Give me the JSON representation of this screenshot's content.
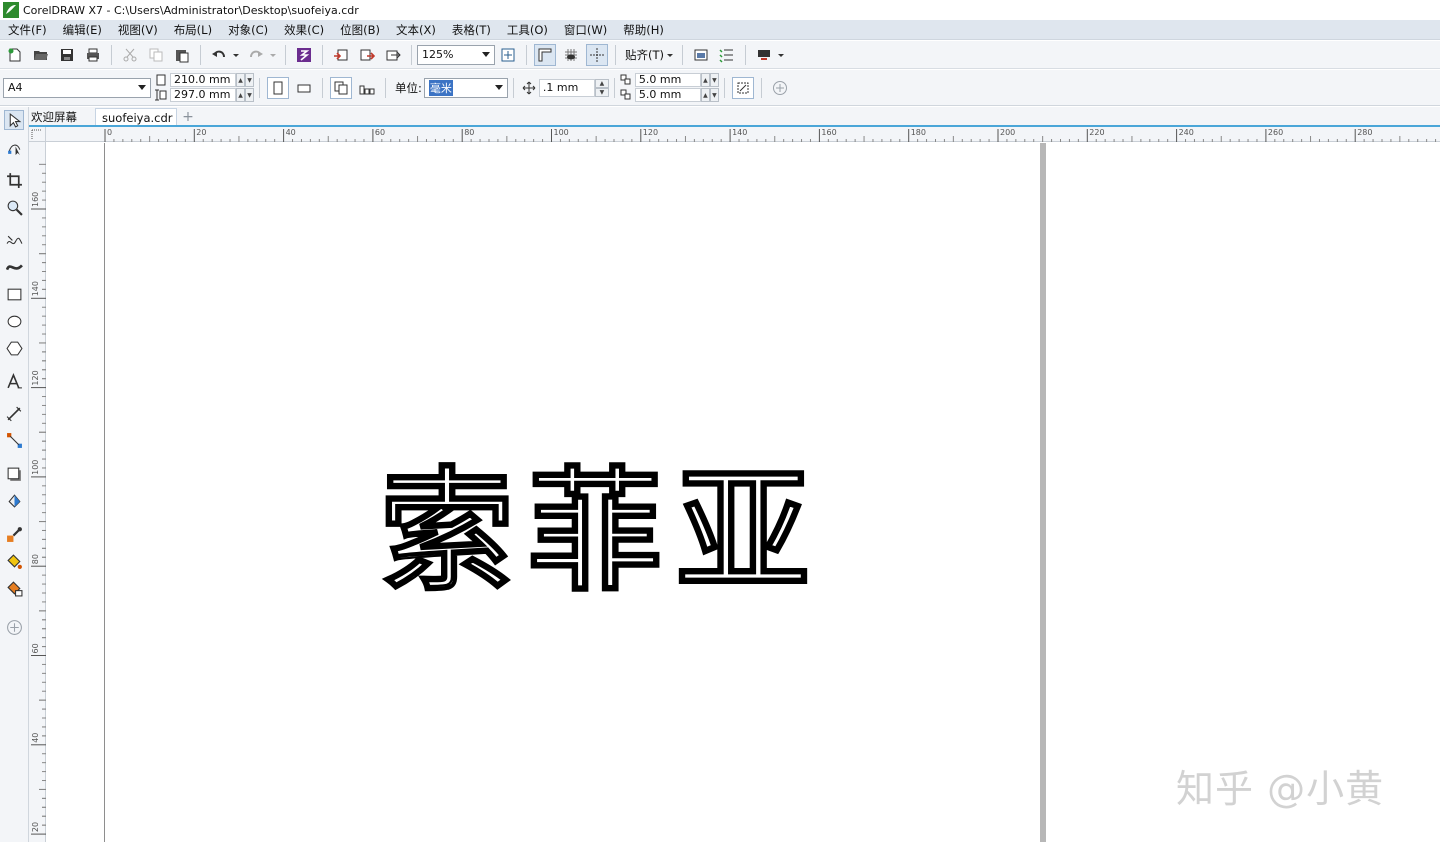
{
  "window": {
    "title": "CorelDRAW X7 - C:\\Users\\Administrator\\Desktop\\suofeiya.cdr"
  },
  "menu": [
    "文件(F)",
    "编辑(E)",
    "视图(V)",
    "布局(L)",
    "对象(C)",
    "效果(C)",
    "位图(B)",
    "文本(X)",
    "表格(T)",
    "工具(O)",
    "窗口(W)",
    "帮助(H)"
  ],
  "standard_toolbar": {
    "zoom_value": "125%",
    "snap_label": "贴齐(T)"
  },
  "property_bar": {
    "page_size": "A4",
    "width": "210.0 mm",
    "height": "297.0 mm",
    "units_label": "单位:",
    "units_value": "毫米",
    "nudge": ".1 mm",
    "dup_x": "5.0 mm",
    "dup_y": "5.0 mm"
  },
  "document_tabs": [
    {
      "label": "欢迎屏幕",
      "active": false
    },
    {
      "label": "suofeiya.cdr",
      "active": true
    }
  ],
  "rulers": {
    "horizontal": [
      "0",
      "20",
      "40",
      "60",
      "80",
      "100",
      "120",
      "140",
      "160",
      "180",
      "200",
      "220",
      "240",
      "260",
      "280"
    ],
    "vertical": [
      "160",
      "140",
      "120",
      "100",
      "80",
      "60",
      "40",
      "20"
    ]
  },
  "artwork": {
    "text": "索菲亚",
    "style": "outline calligraphy"
  },
  "watermark": "知乎 @小黄",
  "colors": {
    "menubar_bg": "#dfe6ee",
    "toolbar_bg": "#f3f5f8",
    "active_tab_line": "#4aa6d8",
    "accent_purple": "#6b2d8f"
  }
}
